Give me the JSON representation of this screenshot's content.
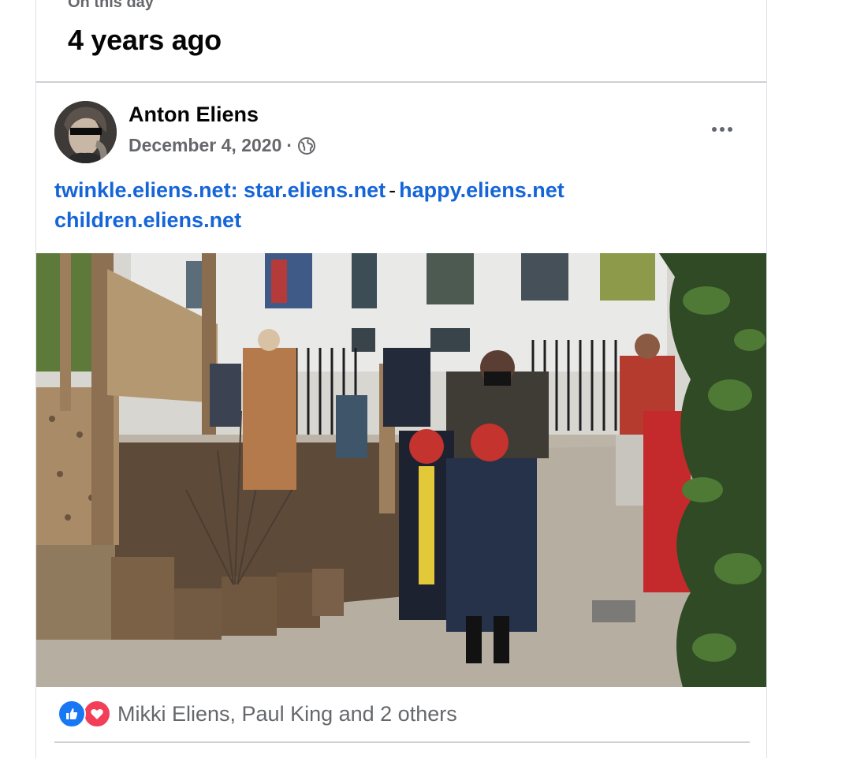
{
  "memory": {
    "kicker": "On this day",
    "title": "4 years ago"
  },
  "post": {
    "author": "Anton Eliens",
    "date": "December 4, 2020",
    "separator": "·",
    "privacy_icon": "globe-icon",
    "more_icon": "more-horizontal-icon",
    "links": [
      {
        "text": "twinkle.eliens.net: star.eliens.net"
      },
      {
        "text": "happy.eliens.net"
      },
      {
        "text": "children.eliens.net"
      }
    ],
    "link_separator": "-"
  },
  "reactions": {
    "icons": [
      "like-icon",
      "love-icon"
    ],
    "summary": "Mikki Eliens, Paul King and 2 others"
  },
  "colors": {
    "link": "#1565d8",
    "secondary_text": "#65676b",
    "like": "#1877f2",
    "love": "#f33e58"
  }
}
